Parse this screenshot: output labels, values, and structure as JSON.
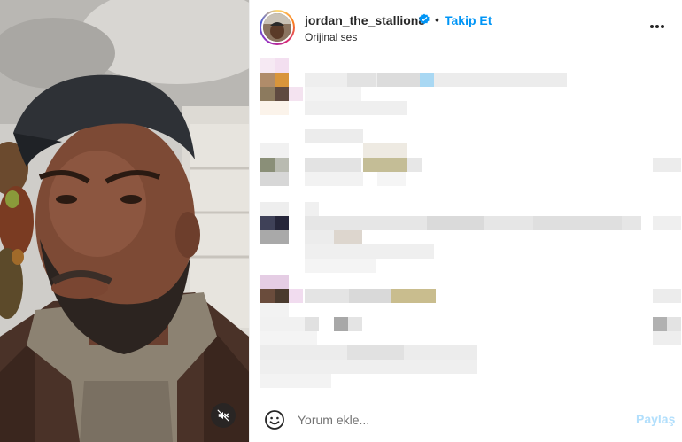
{
  "post": {
    "username": "jordan_the_stallion8",
    "verified": true,
    "separator": "•",
    "follow_label": "Takip Et",
    "audio_label": "Orijinal ses"
  },
  "media": {
    "muted": true,
    "mute_icon": "speaker-muted-icon"
  },
  "footer": {
    "emoji_icon": "smiley-icon",
    "comment_placeholder": "Yorum ekle...",
    "share_label": "Paylaş"
  },
  "comments": {
    "blurred": true,
    "count_visible": 5
  },
  "colors": {
    "accent": "#0095f6",
    "text": "#262626",
    "muted_text": "#737373",
    "disabled_button": "#b2dffc"
  }
}
